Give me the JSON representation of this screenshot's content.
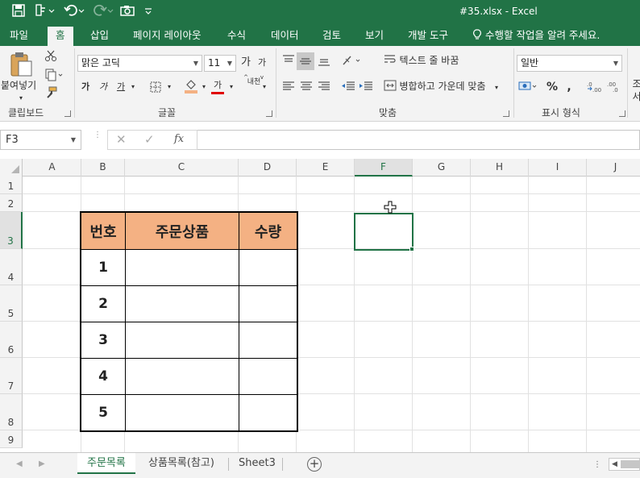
{
  "app": {
    "title": "#35.xlsx - Excel"
  },
  "ribbon_tabs": [
    "파일",
    "홈",
    "삽입",
    "페이지 레이아웃",
    "수식",
    "데이터",
    "검토",
    "보기",
    "개발 도구"
  ],
  "tell_me": "수행할 작업을 알려 주세요.",
  "clipboard": {
    "paste_label": "붙여넣기",
    "group_label": "클립보드"
  },
  "font": {
    "name": "맑은 고딕",
    "size": "11",
    "bold": "가",
    "italic": "가",
    "underline": "가",
    "color_text": "가",
    "phonetic": "내천",
    "group_label": "글꼴"
  },
  "alignment": {
    "wrap_text": "텍스트 줄 바꿈",
    "merge_center": "병합하고 가운데 맞춤",
    "group_label": "맞춤"
  },
  "number": {
    "format": "일반",
    "percent": "%",
    "comma": ",",
    "group_label": "표시 형식"
  },
  "styles_partial": {
    "top": "조",
    "bottom": "서"
  },
  "formula_bar": {
    "name_box": "F3",
    "cancel": "✕",
    "enter": "✓",
    "fx": "fx",
    "value": ""
  },
  "columns": [
    "A",
    "B",
    "C",
    "D",
    "E",
    "F",
    "G",
    "H",
    "I",
    "J"
  ],
  "rows": [
    "1",
    "2",
    "3",
    "4",
    "5",
    "6",
    "7",
    "8",
    "9"
  ],
  "selected_cell": {
    "column": "F",
    "row": "3"
  },
  "table": {
    "headers": [
      "번호",
      "주문상품",
      "수량"
    ],
    "rows": [
      [
        "1",
        "",
        ""
      ],
      [
        "2",
        "",
        ""
      ],
      [
        "3",
        "",
        ""
      ],
      [
        "4",
        "",
        ""
      ],
      [
        "5",
        "",
        ""
      ]
    ],
    "header_color": "#f4b183"
  },
  "sheet_tabs": [
    "주문목록",
    "상품목록(참고)",
    "Sheet3"
  ],
  "active_sheet": "주문목록",
  "colors": {
    "accent": "#217346",
    "ribbon_bg": "#f3f3f3"
  }
}
